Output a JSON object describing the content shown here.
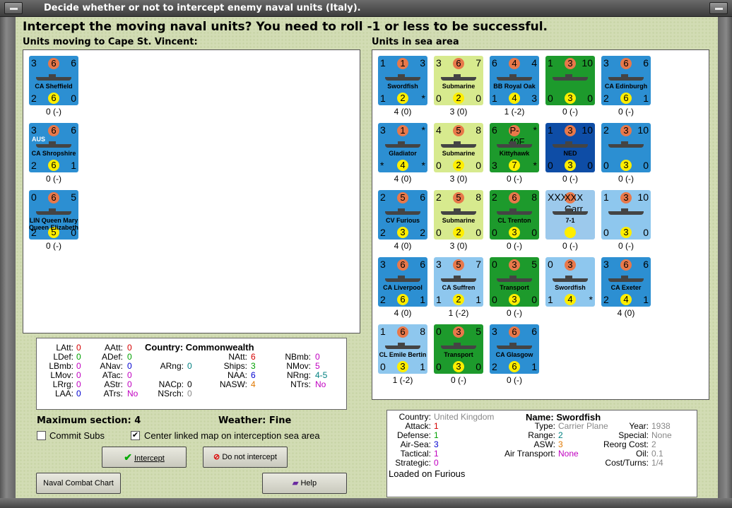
{
  "window": {
    "title": "Decide whether or not to intercept enemy naval units (Italy)."
  },
  "heading": "Intercept the moving naval units?  You need to roll -1 or less to be successful.",
  "left_title": "Units moving to Cape St. Vincent:",
  "right_title": "Units in sea area",
  "moving_units": [
    {
      "tl": "3",
      "top": "6",
      "tr": "6",
      "name": "CA Sheffield",
      "bl": "2",
      "bot": "6",
      "br": "0",
      "cap": "0 (-)"
    },
    {
      "tl": "3",
      "top": "6",
      "tr": "6",
      "name": "CA Shropshire",
      "tag": "AUS",
      "bl": "2",
      "bot": "6",
      "br": "1",
      "cap": "0 (-)"
    },
    {
      "tl": "0",
      "top": "6",
      "tr": "5",
      "name": "LIN Queen Mary Queen Elizabeth",
      "bl": "2",
      "bot": "5",
      "br": "0",
      "cap": "0 (-)"
    }
  ],
  "sea_units": [
    {
      "tl": "1",
      "top": "1",
      "tr": "3",
      "name": "Swordfish",
      "bl": "1",
      "bot": "2",
      "br": "*",
      "cap": "4 (0)"
    },
    {
      "tl": "3",
      "top": "6",
      "tr": "7",
      "name": "Submarine",
      "bl": "0",
      "bot": "2",
      "br": "0",
      "cap": "3 (0)"
    },
    {
      "tl": "6",
      "top": "4",
      "tr": "4",
      "name": "BB Royal Oak",
      "bl": "1",
      "bot": "4",
      "br": "3",
      "cap": "1 (-2)"
    },
    {
      "tl": "1",
      "top": "3",
      "tr": "10",
      "name": "",
      "bl": "0",
      "bot": "3",
      "br": "0",
      "cap": "0 (-)"
    },
    {
      "tl": "3",
      "top": "6",
      "tr": "6",
      "name": "CA Edinburgh",
      "bl": "2",
      "bot": "6",
      "br": "1",
      "cap": "0 (-)"
    },
    {
      "tl": "3",
      "top": "1",
      "tr": "*",
      "name": "Gladiator",
      "bl": "*",
      "bot": "4",
      "br": "*",
      "cap": "4 (0)"
    },
    {
      "tl": "4",
      "top": "5",
      "tr": "8",
      "name": "Submarine",
      "bl": "0",
      "bot": "2",
      "br": "0",
      "cap": "3 (0)"
    },
    {
      "tl": "6",
      "top": "P-40F",
      "tr": "*",
      "name": "Kittyhawk",
      "bl": "3",
      "bot": "7",
      "br": "*",
      "cap": "0 (-)"
    },
    {
      "tl": "1",
      "top": "3",
      "tr": "10",
      "name": "NED",
      "bl": "0",
      "bot": "3",
      "br": "0",
      "cap": "0 (-)"
    },
    {
      "tl": "2",
      "top": "3",
      "tr": "10",
      "name": "",
      "bl": "0",
      "bot": "3",
      "br": "0",
      "cap": "0 (-)"
    },
    {
      "tl": "2",
      "top": "5",
      "tr": "6",
      "name": "CV Furious",
      "bl": "2",
      "bot": "3",
      "br": "2",
      "cap": "4 (0)"
    },
    {
      "tl": "2",
      "top": "5",
      "tr": "8",
      "name": "Submarine",
      "bl": "0",
      "bot": "2",
      "br": "0",
      "cap": "3 (0)"
    },
    {
      "tl": "2",
      "top": "6",
      "tr": "8",
      "name": "CL Trenton",
      "bl": "0",
      "bot": "3",
      "br": "0",
      "cap": "0 (-)"
    },
    {
      "tl": "XXX",
      "top": "XXX Garr",
      "tr": "",
      "name": "7-1",
      "bl": "",
      "bot": "",
      "br": "",
      "cap": "0 (-)"
    },
    {
      "tl": "1",
      "top": "3",
      "tr": "10",
      "name": "",
      "bl": "0",
      "bot": "3",
      "br": "0",
      "cap": "0 (-)"
    },
    {
      "tl": "3",
      "top": "6",
      "tr": "6",
      "name": "CA Liverpool",
      "bl": "2",
      "bot": "6",
      "br": "1",
      "cap": "4 (0)"
    },
    {
      "tl": "3",
      "top": "5",
      "tr": "7",
      "name": "CA Suffren",
      "bl": "1",
      "bot": "2",
      "br": "1",
      "cap": "1 (-2)"
    },
    {
      "tl": "0",
      "top": "3",
      "tr": "5",
      "name": "Transport",
      "bl": "0",
      "bot": "3",
      "br": "0",
      "cap": "0 (-)"
    },
    {
      "tl": "0",
      "top": "3",
      "tr": "",
      "name": "Swordfish",
      "bl": "1",
      "bot": "4",
      "br": "*",
      "cap": ""
    },
    {
      "tl": "3",
      "top": "6",
      "tr": "6",
      "name": "CA Exeter",
      "bl": "2",
      "bot": "4",
      "br": "1",
      "cap": "4 (0)"
    },
    {
      "tl": "1",
      "top": "6",
      "tr": "8",
      "name": "CL Emile Bertin",
      "bl": "0",
      "bot": "3",
      "br": "1",
      "cap": "1 (-2)"
    },
    {
      "tl": "0",
      "top": "3",
      "tr": "5",
      "name": "Transport",
      "bl": "0",
      "bot": "3",
      "br": "0",
      "cap": "0 (-)"
    },
    {
      "tl": "3",
      "top": "6",
      "tr": "6",
      "name": "CA Glasgow",
      "bl": "2",
      "bot": "6",
      "br": "1",
      "cap": "0 (-)"
    }
  ],
  "stats": {
    "latt_l": "LAtt:",
    "latt": "0",
    "ldef_l": "LDef:",
    "ldef": "0",
    "lbmb_l": "LBmb:",
    "lbmb": "0",
    "lmov_l": "LMov:",
    "lmov": "0",
    "lrg_l": "LRrg:",
    "lrg": "0",
    "laa_l": "LAA:",
    "laa": "0",
    "aatt_l": "AAtt:",
    "aatt": "0",
    "adef_l": "ADef:",
    "adef": "0",
    "anav_l": "ANav:",
    "anav": "0",
    "atac_l": "ATac:",
    "atac": "0",
    "astr_l": "AStr:",
    "astr": "0",
    "atrs_l": "ATrs:",
    "atrs": "No",
    "country": "Country: Commonwealth",
    "arng_l": "ARng:",
    "arng": "0",
    "nacp_l": "NACp:",
    "nacp": "0",
    "nsrch_l": "NSrch:",
    "nsrch": "0",
    "natt_l": "NAtt:",
    "natt": "6",
    "ships_l": "Ships:",
    "ships": "3",
    "naa_l": "NAA:",
    "naa": "6",
    "nasw_l": "NASW:",
    "nasw": "4",
    "nbmb_l": "NBmb:",
    "nbmb": "0",
    "nmov_l": "NMov:",
    "nmov": "5",
    "nrng_l": "NRng:",
    "nrng": "4-5",
    "ntrs_l": "NTrs:",
    "ntrs": "No"
  },
  "max_section": "Maximum section: 4",
  "weather": "Weather:  Fine",
  "commit_subs": "Commit Subs",
  "center_map": "Center linked map on interception sea area",
  "intercept_btn": "Intercept",
  "no_intercept_btn": "Do not intercept",
  "naval_chart_btn": "Naval Combat Chart",
  "help_btn": "Help",
  "info": {
    "country_l": "Country:",
    "country": "United Kingdom",
    "attack_l": "Attack:",
    "attack": "1",
    "defense_l": "Defense:",
    "defense": "1",
    "airsea_l": "Air-Sea:",
    "airsea": "3",
    "tactical_l": "Tactical:",
    "tactical": "1",
    "strategic_l": "Strategic:",
    "strategic": "0",
    "loaded": "Loaded on Furious",
    "name": "Name: Swordfish",
    "type_l": "Type:",
    "type": "Carrier Plane",
    "range_l": "Range:",
    "range": "2",
    "asw_l": "ASW:",
    "asw": "3",
    "airtr_l": "Air Transport:",
    "airtr": "None",
    "year_l": "Year:",
    "year": "1938",
    "special_l": "Special:",
    "special": "None",
    "reorg_l": "Reorg Cost:",
    "reorg": "2",
    "oil_l": "Oil:",
    "oil": "0.1",
    "cost_l": "Cost/Turns:",
    "cost": "1/4"
  }
}
